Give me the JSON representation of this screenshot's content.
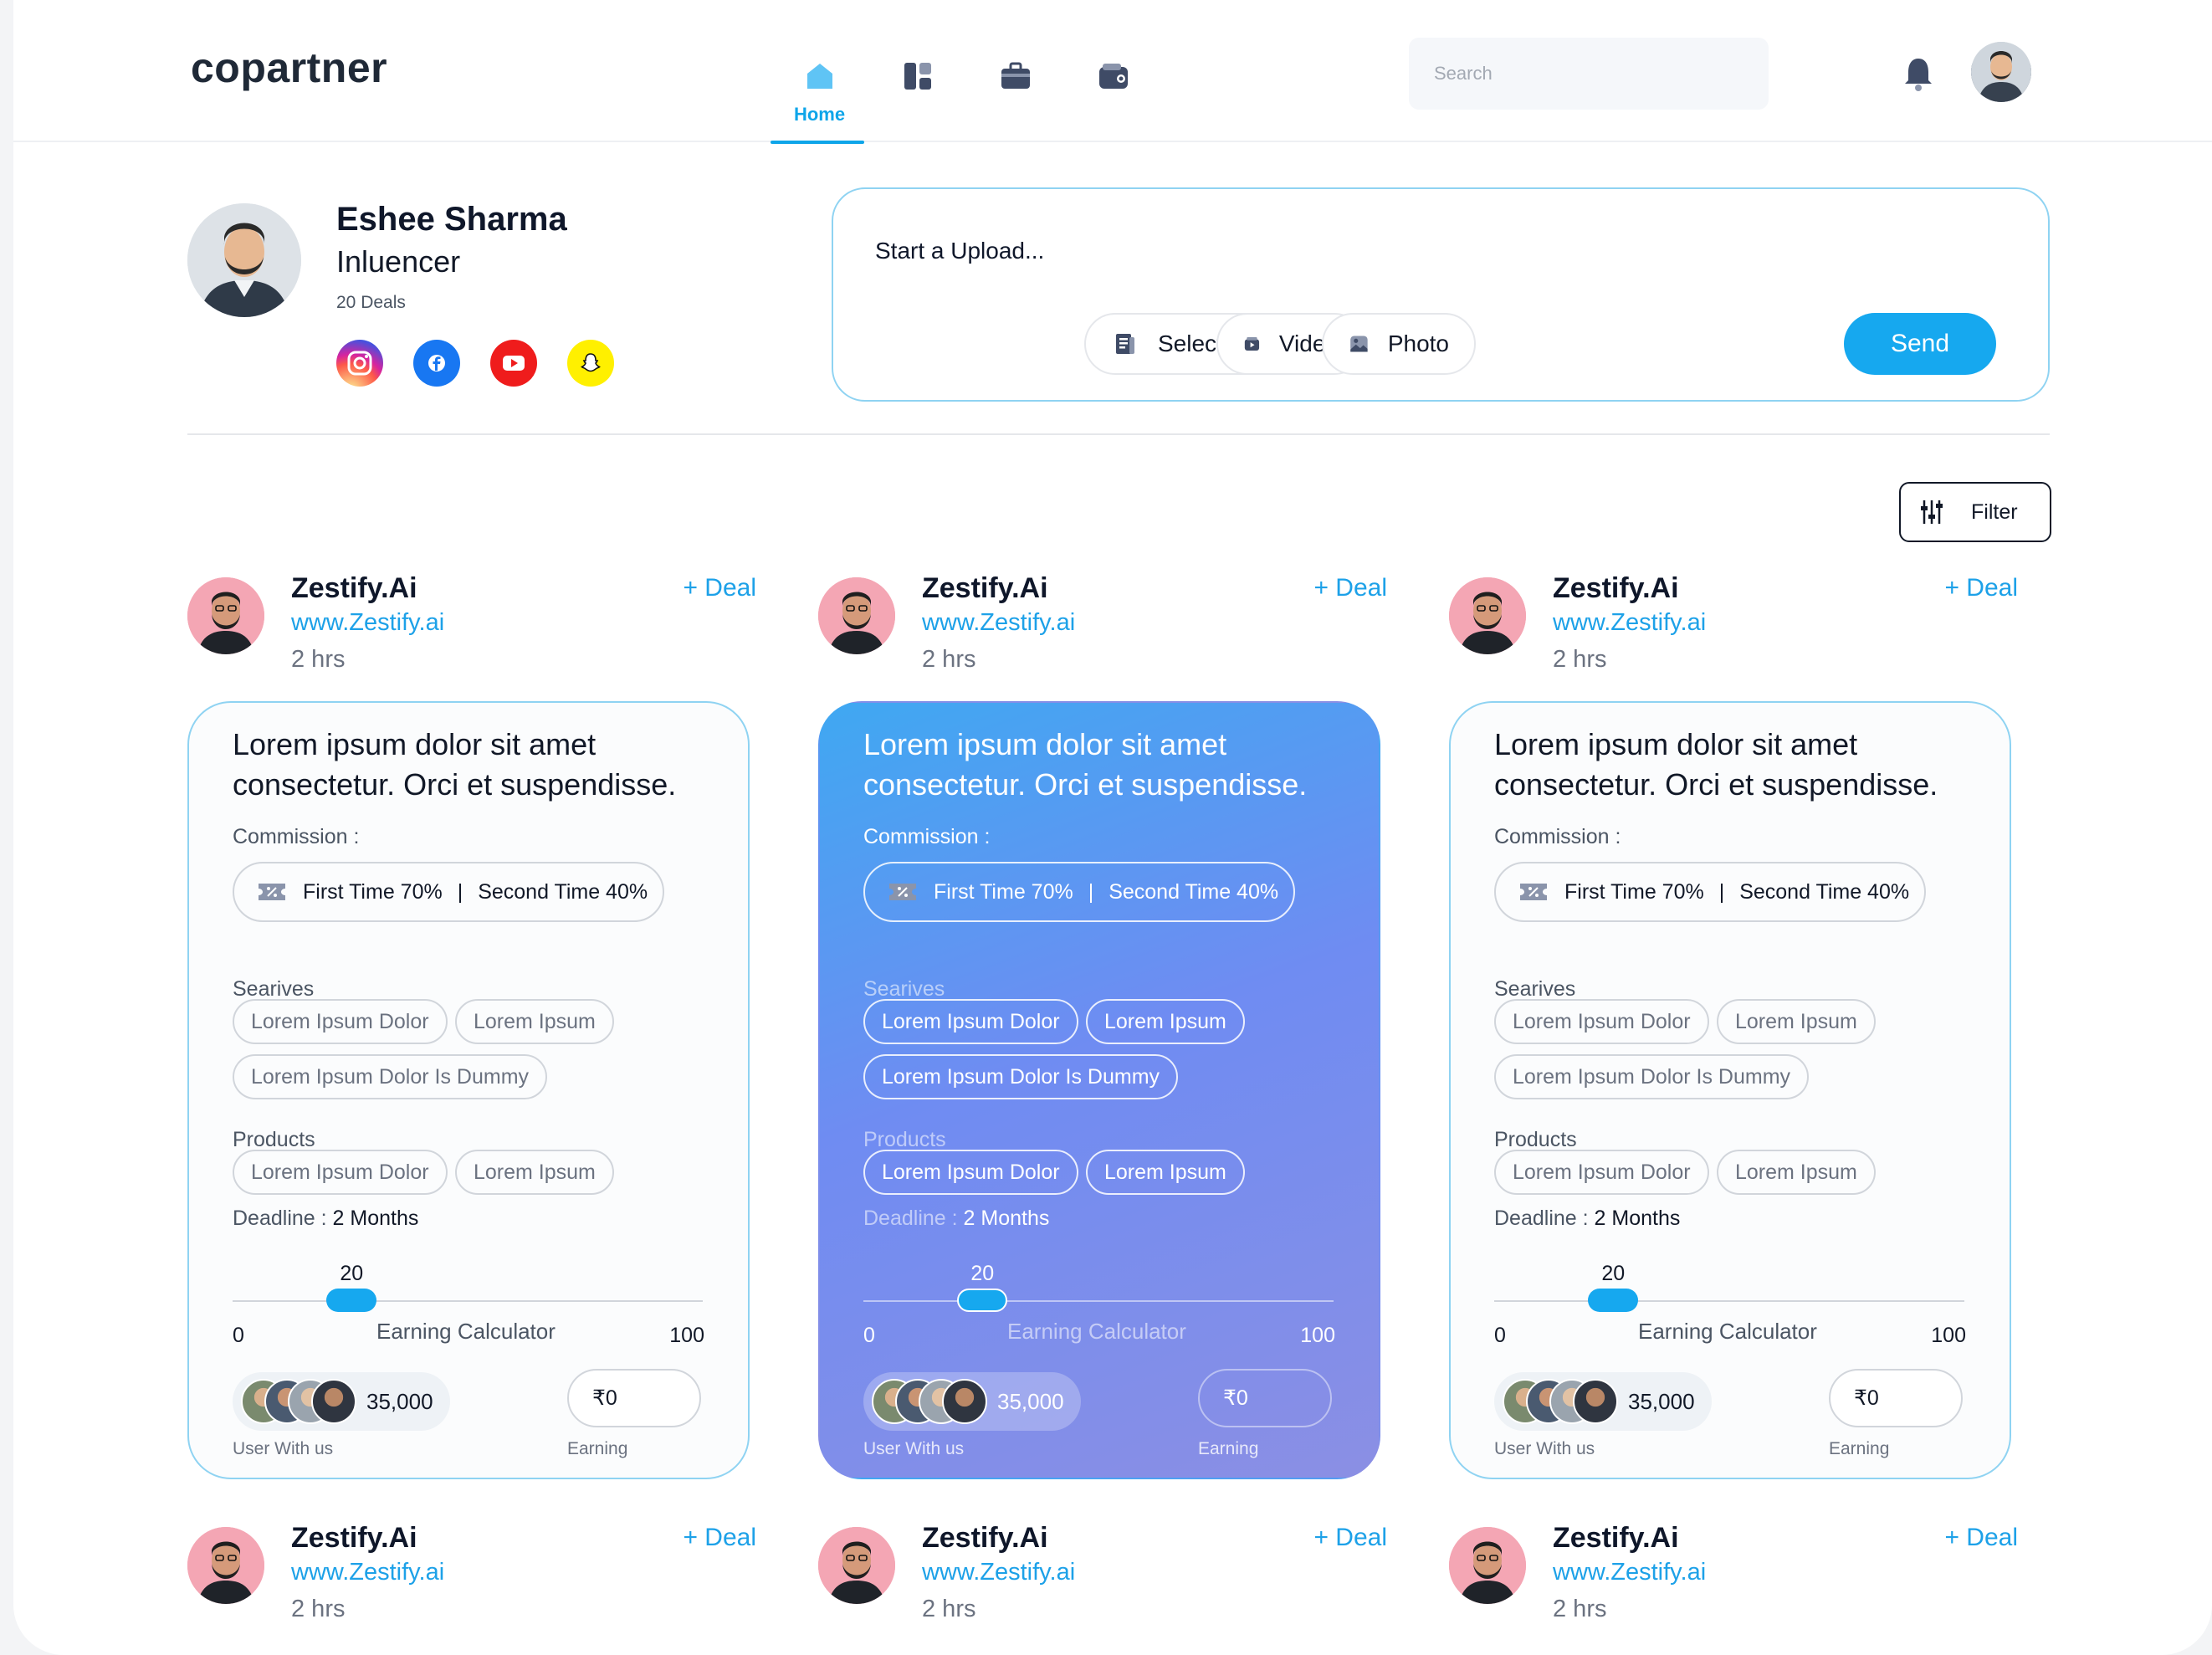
{
  "header": {
    "logo": "copartner",
    "nav": [
      {
        "label": "Home",
        "icon": "home-icon"
      },
      {
        "label": "",
        "icon": "dashboard-icon"
      },
      {
        "label": "",
        "icon": "briefcase-icon"
      },
      {
        "label": "",
        "icon": "wallet-icon"
      }
    ],
    "search_placeholder": "Search"
  },
  "profile": {
    "name": "Eshee Sharma",
    "role": "Inluencer",
    "deals": "20 Deals",
    "socials": [
      "instagram-icon",
      "facebook-icon",
      "youtube-icon",
      "snapchat-icon"
    ]
  },
  "upload": {
    "title": "Start a Upload...",
    "select": "Select",
    "video": "Video",
    "photo": "Photo",
    "send": "Send"
  },
  "filter": "Filter",
  "deal": {
    "title": "Zestify.Ai",
    "url": "www.Zestify.ai",
    "time": "2 hrs",
    "add": "+ Deal"
  },
  "card": {
    "description": "Lorem ipsum dolor sit amet consectetur. Orci et suspendisse.",
    "commission_label": "Commission :",
    "first_time": "First Time 70%",
    "separator": "|",
    "second_time": "Second Time 40%",
    "services_label": "Searives",
    "services": [
      "Lorem Ipsum Dolor",
      "Lorem Ipsum",
      "Lorem Ipsum Dolor Is Dummy"
    ],
    "products_label": "Products",
    "products": [
      "Lorem Ipsum Dolor",
      "Lorem Ipsum"
    ],
    "deadline_label": "Deadline :",
    "deadline_value": "2 Months",
    "slider_value": "20",
    "slider_min": "0",
    "slider_max": "100",
    "slider_fraction": 0.2,
    "calculator_label": "Earning Calculator",
    "users_count": "35,000",
    "users_label": "User With us",
    "earning_value": "₹0",
    "earning_label": "Earning"
  },
  "colors": {
    "accent": "#16a8ef",
    "link": "#1da1e8",
    "border": "#8fd3f2"
  }
}
